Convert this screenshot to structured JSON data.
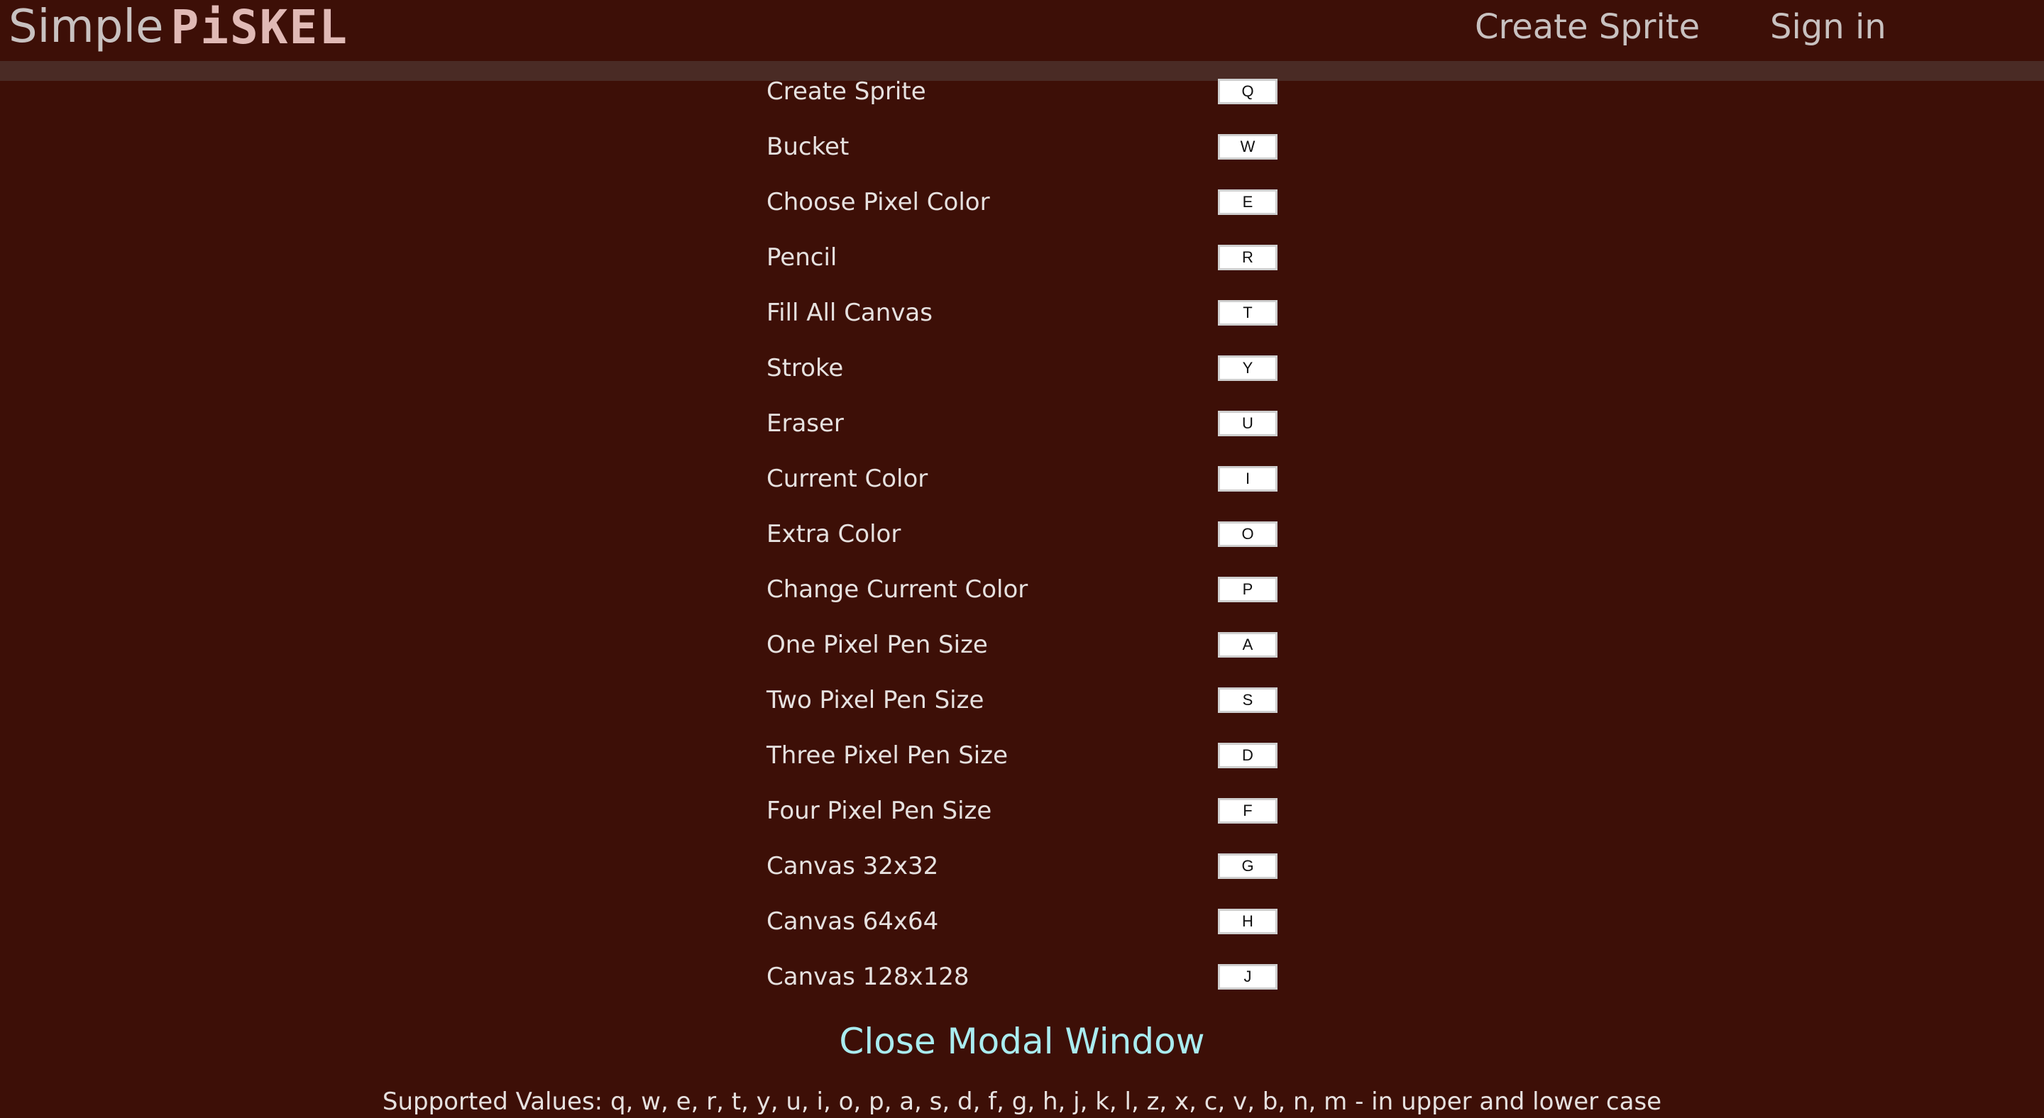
{
  "header": {
    "logo_simple": "Simple",
    "logo_piskel": "PiSKEL",
    "nav_create": "Create Sprite",
    "nav_signin": "Sign in"
  },
  "shortcuts": [
    {
      "label": "Create Sprite",
      "key": "Q"
    },
    {
      "label": "Bucket",
      "key": "W"
    },
    {
      "label": "Choose Pixel Color",
      "key": "E"
    },
    {
      "label": "Pencil",
      "key": "R"
    },
    {
      "label": "Fill All Canvas",
      "key": "T"
    },
    {
      "label": "Stroke",
      "key": "Y"
    },
    {
      "label": "Eraser",
      "key": "U"
    },
    {
      "label": "Current Color",
      "key": "I"
    },
    {
      "label": "Extra Color",
      "key": "O"
    },
    {
      "label": "Change Current Color",
      "key": "P"
    },
    {
      "label": "One Pixel Pen Size",
      "key": "A"
    },
    {
      "label": "Two Pixel Pen Size",
      "key": "S"
    },
    {
      "label": "Three Pixel Pen Size",
      "key": "D"
    },
    {
      "label": "Four Pixel Pen Size",
      "key": "F"
    },
    {
      "label": "Canvas 32x32",
      "key": "G"
    },
    {
      "label": "Canvas 64x64",
      "key": "H"
    },
    {
      "label": "Canvas 128x128",
      "key": "J"
    }
  ],
  "modal": {
    "close_label": "Close Modal Window",
    "supported_values": "Supported Values: q, w, e, r, t, y, u, i, o, p, a, s, d, f, g, h, j, k, l, z, x, c, v, b, n, m - in upper and lower case"
  },
  "colors": {
    "background": "#3d0f07",
    "header_bar": "#4a2b25",
    "close_link": "#a9ecf0",
    "logo_accent": "#e0b9b5"
  }
}
